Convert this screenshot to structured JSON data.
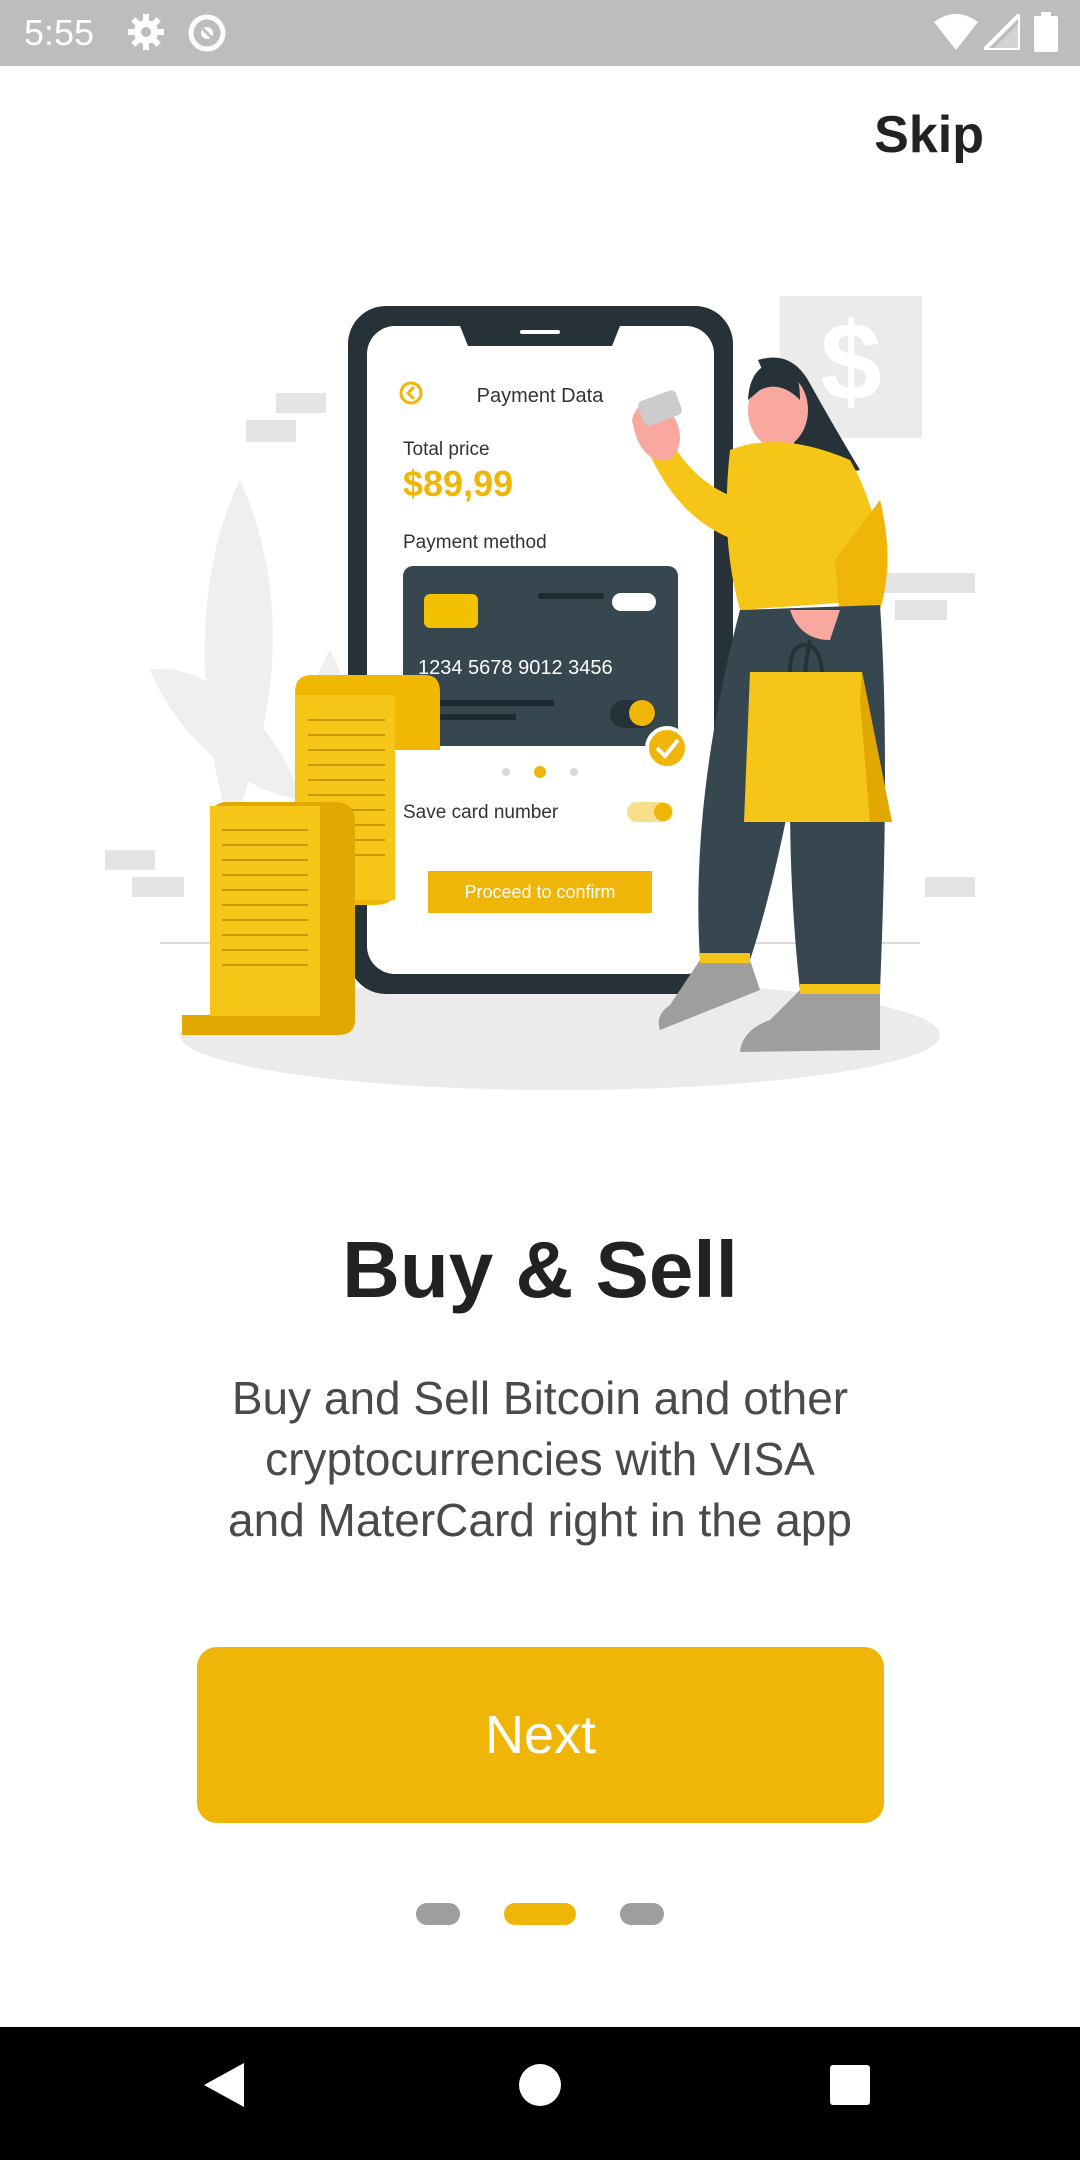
{
  "status_bar": {
    "time": "5:55",
    "icons": [
      "gear-icon",
      "sync-icon",
      "wifi-icon",
      "signal-icon",
      "battery-icon"
    ]
  },
  "header": {
    "skip_label": "Skip"
  },
  "illustration": {
    "screen_title": "Payment Data",
    "total_price_label": "Total price",
    "total_price_value": "$89,99",
    "payment_method_label": "Payment method",
    "card_number": "1234  5678  9012  3456",
    "save_card_label": "Save card number",
    "proceed_label": "Proceed to confirm",
    "dollar_sign": "$"
  },
  "onboarding": {
    "title": "Buy & Sell",
    "description_line1": "Buy and Sell Bitcoin and other",
    "description_line2": "cryptocurrencies with VISA",
    "description_line3": "and MaterCard right in the app",
    "next_label": "Next",
    "page_count": 3,
    "active_page": 2
  },
  "colors": {
    "accent": "#efb507",
    "dark": "#2f4550",
    "status_bar": "#bdbdbd",
    "text_primary": "#222222",
    "text_secondary": "#4a4a4a"
  },
  "nav_bar": {
    "buttons": [
      "back-icon",
      "home-icon",
      "recents-icon"
    ]
  }
}
